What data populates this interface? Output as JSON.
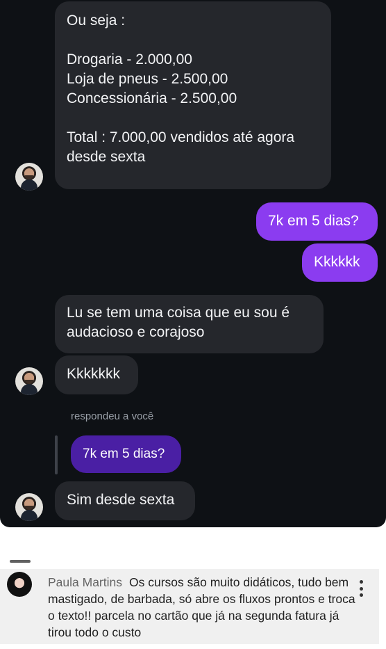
{
  "chat": {
    "messages": [
      {
        "id": "m1",
        "from": "them",
        "text": "Ou seja :\n\nDrogaria - 2.000,00\nLoja de pneus - 2.500,00\nConcessionária - 2.500,00\n\nTotal : 7.000,00 vendidos até agora desde sexta"
      },
      {
        "id": "m2",
        "from": "me",
        "text": "7k em 5 dias?"
      },
      {
        "id": "m3",
        "from": "me",
        "text": "Kkkkkk"
      },
      {
        "id": "m4",
        "from": "them",
        "text": "Lu se tem uma coisa que eu sou é audacioso e corajoso"
      },
      {
        "id": "m5",
        "from": "them",
        "text": "Kkkkkkk"
      },
      {
        "id": "m6",
        "from": "them",
        "text": "Sim desde sexta",
        "reply_note": "respondeu a você",
        "quoted_text": "7k em 5 dias?"
      }
    ],
    "colors": {
      "background": "#0e1115",
      "incoming": "#25272c",
      "outgoing": "#8b3cf0",
      "quoted": "#4a1fa4"
    }
  },
  "comment": {
    "author": "Paula Martins",
    "text": "Os cursos são muito didáticos, tudo bem mastigado, de barbada, só abre os fluxos prontos e troca o texto!! parcela no cartão que já na segunda fatura já tirou todo o custo",
    "menu_icon": "more-vertical-icon"
  }
}
